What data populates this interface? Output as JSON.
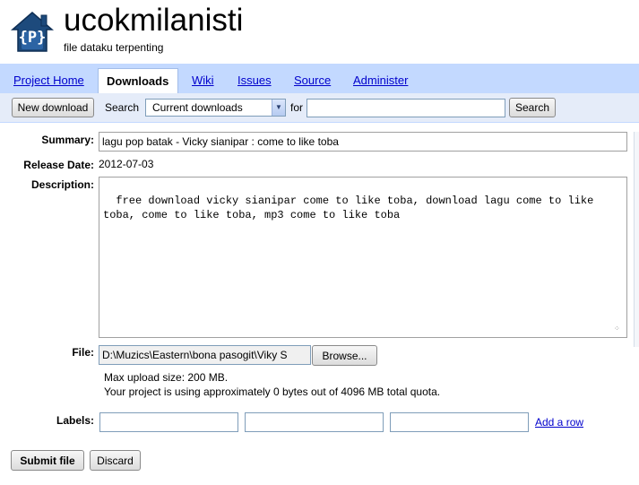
{
  "header": {
    "logo_text": "{P}",
    "project_name": "ucokmilanisti",
    "project_summary": "file dataku terpenting"
  },
  "tabs": [
    {
      "label": "Project Home"
    },
    {
      "label": "Downloads",
      "active": true
    },
    {
      "label": "Wiki"
    },
    {
      "label": "Issues"
    },
    {
      "label": "Source"
    },
    {
      "label": "Administer"
    }
  ],
  "toolbar": {
    "new_download_label": "New download",
    "search_label": "Search",
    "search_scope": "Current downloads",
    "for_label": "for",
    "search_query": "",
    "search_button_label": "Search"
  },
  "form": {
    "summary_label": "Summary:",
    "summary_value": "lagu pop batak - Vicky sianipar : come to like toba",
    "release_date_label": "Release Date:",
    "release_date_value": "2012-07-03",
    "description_label": "Description:",
    "description_value": "free download vicky sianipar come to like toba, download lagu come to like toba, come to like toba, mp3 come to like toba",
    "file_label": "File:",
    "file_value": "D:\\Muzics\\Eastern\\bona pasogit\\Viky S",
    "browse_label": "Browse...",
    "max_upload": "Max upload size: 200 MB.",
    "quota": "Your project is using approximately 0 bytes out of 4096 MB total quota.",
    "labels_label": "Labels:",
    "label_values": [
      "",
      "",
      ""
    ],
    "add_row_label": "Add a row",
    "submit_label": "Submit file",
    "discard_label": "Discard"
  },
  "colors": {
    "tab_bar": "#c3d9ff",
    "toolbar": "#e5ecf9",
    "link": "#0000cc",
    "logo_bg": "#1d4a7c"
  }
}
